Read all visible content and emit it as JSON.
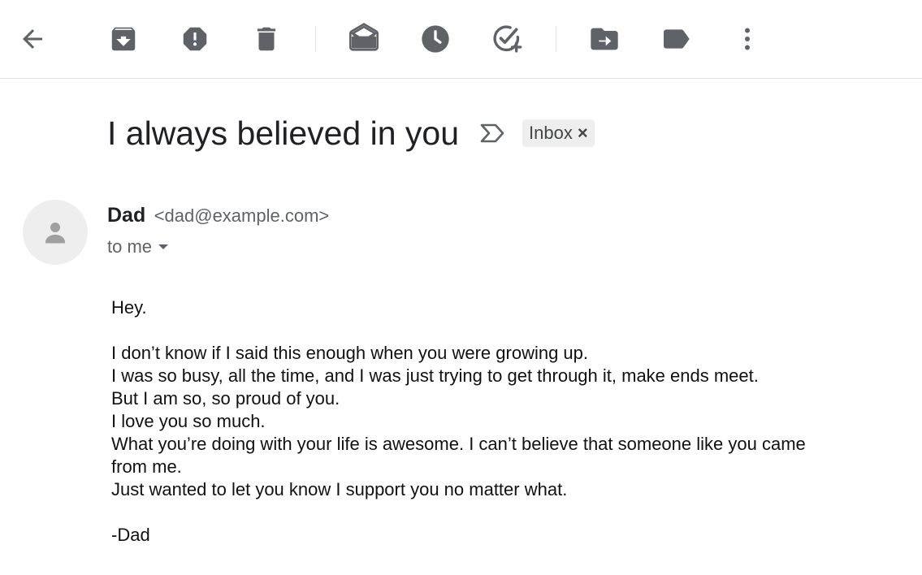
{
  "toolbar": {
    "back_icon": "arrow-left-icon",
    "archive_icon": "archive-icon",
    "spam_icon": "report-spam-icon",
    "delete_icon": "trash-icon",
    "mark_unread_icon": "mark-unread-icon",
    "snooze_icon": "clock-icon",
    "add_task_icon": "add-task-icon",
    "move_icon": "move-to-icon",
    "label_icon": "label-icon",
    "more_icon": "more-vert-icon",
    "icon_color": "#5f6368"
  },
  "email": {
    "subject": "I always believed in you",
    "label_chip": "Inbox",
    "label_remove": "×",
    "sender_name": "Dad",
    "sender_email": "<dad@example.com>",
    "recipient": "to me",
    "body": {
      "greeting": "Hey.",
      "lines": [
        "I don’t know if I said this enough when you were growing up.",
        "I was so busy, all the time, and I was just trying to get through it, make ends meet.",
        "But I am so, so proud of you.",
        "I love you so much.",
        "What you’re doing with your life is awesome. I can’t believe that someone like you came from me.",
        "Just wanted to let you know I support you no matter what."
      ],
      "signature": "-Dad"
    }
  }
}
